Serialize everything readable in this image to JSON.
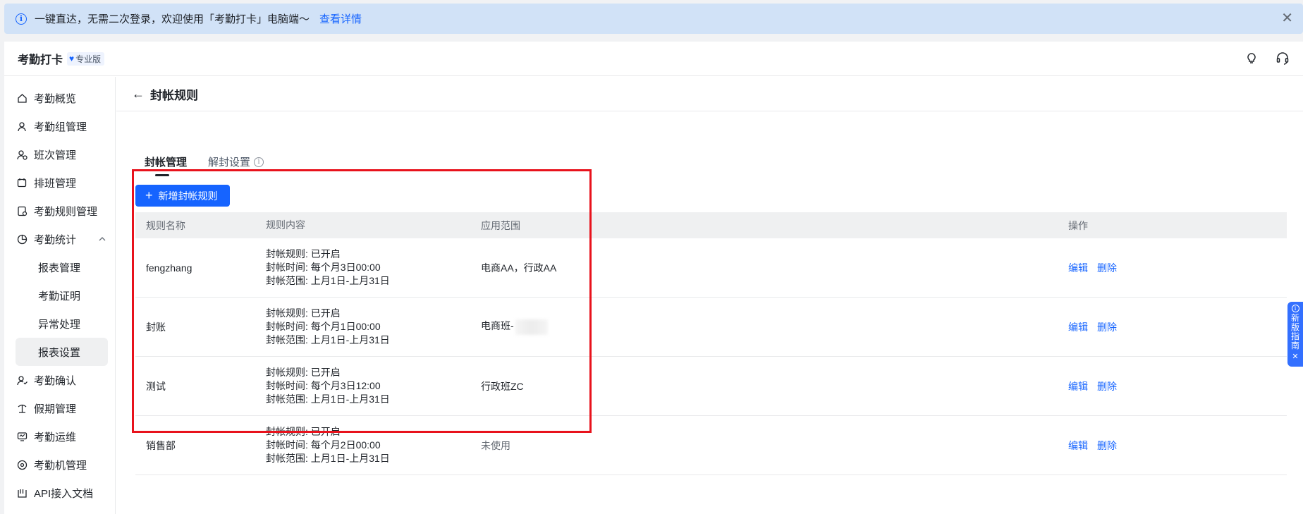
{
  "banner": {
    "text": "一键直达，无需二次登录，欢迎使用「考勤打卡」电脑端～",
    "link": "查看详情",
    "info_icon": "info-circle",
    "close_icon": "✕"
  },
  "header": {
    "app_title": "考勤打卡",
    "edition_badge": "专业版",
    "icons": [
      "lightbulb-icon",
      "headset-icon"
    ]
  },
  "sidebar": {
    "items": [
      {
        "label": "考勤概览",
        "icon": "home-icon"
      },
      {
        "label": "考勤组管理",
        "icon": "user-group-icon"
      },
      {
        "label": "班次管理",
        "icon": "shift-icon"
      },
      {
        "label": "排班管理",
        "icon": "calendar-icon"
      },
      {
        "label": "考勤规则管理",
        "icon": "rules-icon"
      },
      {
        "label": "考勤统计",
        "icon": "pie-chart-icon",
        "expanded": true
      },
      {
        "label": "报表管理"
      },
      {
        "label": "考勤证明"
      },
      {
        "label": "异常处理"
      },
      {
        "label": "报表设置",
        "active": true
      },
      {
        "label": "考勤确认",
        "icon": "user-check-icon"
      },
      {
        "label": "假期管理",
        "icon": "palm-tree-icon"
      },
      {
        "label": "考勤运维",
        "icon": "monitor-icon"
      },
      {
        "label": "考勤机管理",
        "icon": "device-icon"
      },
      {
        "label": "API接入文档",
        "icon": "api-doc-icon"
      }
    ]
  },
  "page": {
    "back_arrow": "←",
    "title": "封帐规则",
    "tabs": [
      {
        "label": "封帐管理",
        "active": true
      },
      {
        "label": "解封设置",
        "active": false
      }
    ],
    "add_button": "新增封帐规则",
    "add_button_plus": "+"
  },
  "table": {
    "columns": [
      "规则名称",
      "规则内容",
      "应用范围",
      "操作"
    ],
    "rows": [
      {
        "name": "fengzhang",
        "content": [
          "封帐规则: 已开启",
          "封帐时间: 每个月3日00:00",
          "封帐范围: 上月1日-上月31日"
        ],
        "scope": "电商AA，行政AA",
        "actions": [
          "编辑",
          "删除"
        ]
      },
      {
        "name": "封账",
        "content": [
          "封帐规则: 已开启",
          "封帐时间: 每个月1日00:00",
          "封帐范围: 上月1日-上月31日"
        ],
        "scope": "电商班-",
        "actions": [
          "编辑",
          "删除"
        ]
      },
      {
        "name": "测试",
        "content": [
          "封帐规则: 已开启",
          "封帐时间: 每个月3日12:00",
          "封帐范围: 上月1日-上月31日"
        ],
        "scope": "行政班ZC",
        "actions": [
          "编辑",
          "删除"
        ]
      },
      {
        "name": "销售部",
        "content": [
          "封帐规则: 已开启",
          "封帐时间: 每个月2日00:00",
          "封帐范围: 上月1日-上月31日"
        ],
        "scope": "未使用",
        "actions": [
          "编辑",
          "删除"
        ]
      }
    ]
  },
  "guide_tab": {
    "chars": [
      "新",
      "版",
      "指",
      "南"
    ],
    "close": "✕"
  },
  "colors": {
    "accent": "#1664ff",
    "banner_bg": "#d1e2f7",
    "highlight_border": "#e8121c",
    "guide_bg": "#3370ff"
  }
}
